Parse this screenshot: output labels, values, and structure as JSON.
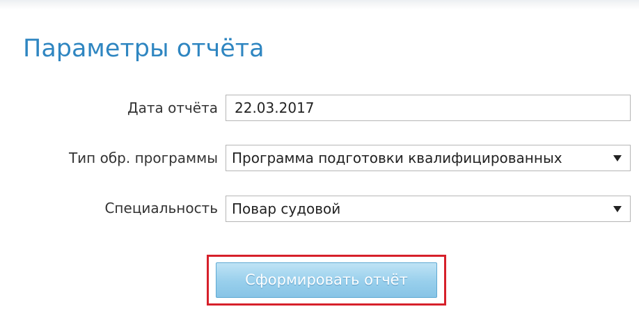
{
  "page_title": "Параметры отчёта",
  "form": {
    "report_date": {
      "label": "Дата отчёта",
      "value": "22.03.2017"
    },
    "program_type": {
      "label": "Тип обр. программы",
      "value": "Программа подготовки квалифицированных",
      "icon": "chevron-down-icon"
    },
    "specialty": {
      "label": "Специальность",
      "value": "Повар судовой",
      "icon": "chevron-down-icon"
    }
  },
  "actions": {
    "generate_report_label": "Сформировать отчёт"
  },
  "colors": {
    "title": "#2f86c1",
    "highlight_border": "#d6202a",
    "button_bg": "#98cfec"
  }
}
